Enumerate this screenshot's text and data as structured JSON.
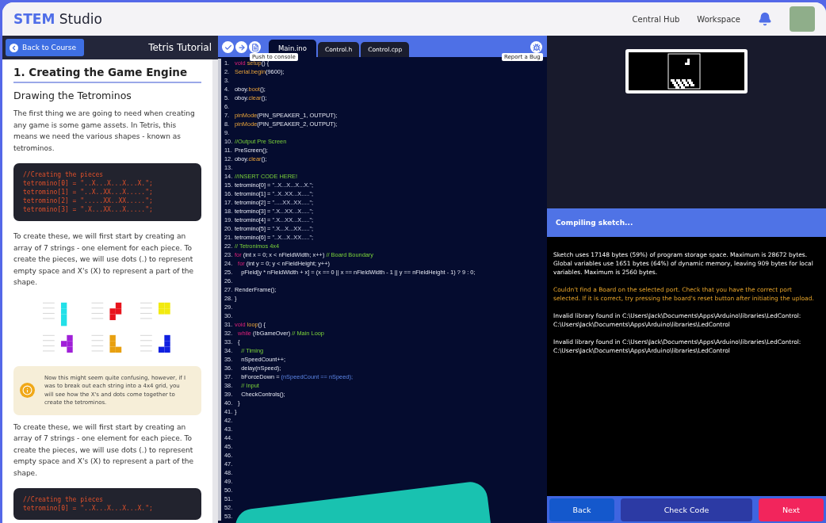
{
  "app": {
    "brand_bold": "STEM",
    "brand_rest": "Studio",
    "nav": [
      "Central Hub",
      "Workspace"
    ]
  },
  "lesson": {
    "back": "Back to Course",
    "title": "Tetris Tutorial",
    "heading": "1. Creating the Game Engine",
    "subheading": "Drawing the Tetrominos",
    "intro": "The first thing we are going to need when creating any game is some game assets. In Tetris, this means we need the various shapes - known as tetrominos.",
    "code_block": [
      "//Creating the pieces",
      "tetromino[0] = \"..X...X...X...X.\";",
      "tetromino[1] = \"..X..XX...X.....\";",
      "tetromino[2] = \".....XX..XX.....\";",
      "tetromino[3] = \".X...XX...X.....\";"
    ],
    "para": "To create these, we will first start by creating an array of 7 strings - one element for each piece. To create the pieces, we will use dots (.) to represent empty space and X's (X) to represent a part of the shape.",
    "pieces": [
      {
        "color": "#22e0e8"
      },
      {
        "color": "#e8141c"
      },
      {
        "color": "#f2ea10"
      },
      {
        "color": "#a020d8"
      },
      {
        "color": "#e8a010"
      },
      {
        "color": "#1020e0"
      }
    ],
    "note": "Now this might seem quite confusing, however, if I was to break out each string into a 4x4 grid, you will see how the X's and dots come together to create the tetrominos.",
    "para2": "To create these, we will first start by creating an array of 7 strings - one element for each piece. To create the pieces, we will use dots (.) to represent empty space and X's (X) to represent a part of the shape.",
    "code_block2": [
      "//Creating the pieces",
      "tetromino[0] = \"..X...X...X...X.\";"
    ]
  },
  "editor": {
    "tooltip_left": "Push to console",
    "tooltip_right": "Report a Bug",
    "tabs": [
      {
        "label": "Main.ino",
        "selected": true
      },
      {
        "label": "Control.h",
        "selected": false
      },
      {
        "label": "Control.cpp",
        "selected": false
      }
    ],
    "lines": [
      {
        "n": "1.",
        "segs": [
          {
            "kind": "kw",
            "text": "void "
          },
          {
            "kind": "fn",
            "text": "setup"
          },
          {
            "kind": "pl",
            "text": "() {"
          }
        ]
      },
      {
        "n": "2.",
        "segs": [
          {
            "kind": "fn",
            "text": "Serial.begin"
          },
          {
            "kind": "pl",
            "text": "(9600);"
          }
        ]
      },
      {
        "n": "3."
      },
      {
        "n": "4.",
        "segs": [
          {
            "kind": "pl",
            "text": "oboy."
          },
          {
            "kind": "fn",
            "text": "boot"
          },
          {
            "kind": "pl",
            "text": "();"
          }
        ]
      },
      {
        "n": "5.",
        "segs": [
          {
            "kind": "pl",
            "text": "oboy."
          },
          {
            "kind": "fn",
            "text": "clear"
          },
          {
            "kind": "pl",
            "text": "();"
          }
        ]
      },
      {
        "n": "6."
      },
      {
        "n": "7.",
        "segs": [
          {
            "kind": "fn",
            "text": "pinMode"
          },
          {
            "kind": "pl",
            "text": "(PIN_SPEAKER_1, OUTPUT);"
          }
        ]
      },
      {
        "n": "8.",
        "segs": [
          {
            "kind": "fn",
            "text": "pinMode"
          },
          {
            "kind": "pl",
            "text": "(PIN_SPEAKER_2, OUTPUT);"
          }
        ]
      },
      {
        "n": "9."
      },
      {
        "n": "10.",
        "segs": [
          {
            "kind": "cm",
            "text": "//Output Pre Screen"
          }
        ]
      },
      {
        "n": "11.",
        "segs": [
          {
            "kind": "pl",
            "text": "PreScreen();"
          }
        ]
      },
      {
        "n": "12.",
        "segs": [
          {
            "kind": "pl",
            "text": "oboy."
          },
          {
            "kind": "fn",
            "text": "clear"
          },
          {
            "kind": "pl",
            "text": "();"
          }
        ]
      },
      {
        "n": "13."
      },
      {
        "n": "14.",
        "segs": [
          {
            "kind": "cm",
            "text": "//INSERT CODE HERE!"
          }
        ]
      },
      {
        "n": "15.",
        "segs": [
          {
            "kind": "pl",
            "text": "tetromino[0] = "
          },
          {
            "kind": "st",
            "text": "\"..X...X...X...X.\";"
          }
        ]
      },
      {
        "n": "16.",
        "segs": [
          {
            "kind": "pl",
            "text": "tetromino[1] = "
          },
          {
            "kind": "st",
            "text": "\"..X..XX...X.....\";"
          }
        ]
      },
      {
        "n": "17.",
        "segs": [
          {
            "kind": "pl",
            "text": "tetromino[2] = "
          },
          {
            "kind": "st",
            "text": "\".....XX..XX.....\";"
          }
        ]
      },
      {
        "n": "18.",
        "segs": [
          {
            "kind": "pl",
            "text": "tetromino[3] = "
          },
          {
            "kind": "st",
            "text": "\".X...XX...X.....\";"
          }
        ]
      },
      {
        "n": "19.",
        "segs": [
          {
            "kind": "pl",
            "text": "tetromino[4] = "
          },
          {
            "kind": "st",
            "text": "\".X...XX...X.....\";"
          }
        ]
      },
      {
        "n": "20.",
        "segs": [
          {
            "kind": "pl",
            "text": "tetromino[5] = "
          },
          {
            "kind": "st",
            "text": "\".X...X...XX.....\";"
          }
        ]
      },
      {
        "n": "21.",
        "segs": [
          {
            "kind": "pl",
            "text": "tetromino[6] = "
          },
          {
            "kind": "st",
            "text": "\"..X...X..XX.....\";"
          }
        ]
      },
      {
        "n": "22.",
        "segs": [
          {
            "kind": "cm",
            "text": "// Tetronimos 4x4"
          }
        ]
      },
      {
        "n": "23.",
        "segs": [
          {
            "kind": "kw",
            "text": "for "
          },
          {
            "kind": "pl",
            "text": "(int x = 0; x < nFieldWidth; x++) "
          },
          {
            "kind": "cm",
            "text": "// Board Boundary"
          }
        ]
      },
      {
        "n": "24.",
        "segs": [
          {
            "kind": "kw",
            "text": "  for "
          },
          {
            "kind": "pl",
            "text": "(int y = 0; y < nFieldHeight; y++)"
          }
        ]
      },
      {
        "n": "25.",
        "segs": [
          {
            "kind": "pl",
            "text": "    pField[y * nFieldWidth + x] = (x == 0 || x == nFieldWidth - 1 || y == nFieldHeight - 1) ? 9 : 0;"
          }
        ]
      },
      {
        "n": "26."
      },
      {
        "n": "27.",
        "segs": [
          {
            "kind": "pl",
            "text": "RenderFrame();"
          }
        ]
      },
      {
        "n": "28.",
        "segs": [
          {
            "kind": "pl",
            "text": "}"
          }
        ]
      },
      {
        "n": "29."
      },
      {
        "n": "30."
      },
      {
        "n": "31.",
        "segs": [
          {
            "kind": "kw",
            "text": "void "
          },
          {
            "kind": "fn",
            "text": "loop"
          },
          {
            "kind": "pl",
            "text": "() {"
          }
        ]
      },
      {
        "n": "32.",
        "segs": [
          {
            "kind": "kw",
            "text": "  while "
          },
          {
            "kind": "pl",
            "text": "(!bGameOver) "
          },
          {
            "kind": "cm",
            "text": "// Main Loop"
          }
        ]
      },
      {
        "n": "33.",
        "segs": [
          {
            "kind": "pl",
            "text": "  {"
          }
        ]
      },
      {
        "n": "34.",
        "segs": [
          {
            "kind": "cm",
            "text": "    // Timing"
          }
        ]
      },
      {
        "n": "35.",
        "segs": [
          {
            "kind": "pl",
            "text": "    nSpeedCount++;"
          }
        ]
      },
      {
        "n": "36.",
        "segs": [
          {
            "kind": "pl",
            "text": "    delay(nSpeed);"
          }
        ]
      },
      {
        "n": "37.",
        "segs": [
          {
            "kind": "pl",
            "text": "    bForceDown = "
          },
          {
            "kind": "op",
            "text": "(nSpeedCount == nSpeed);"
          }
        ]
      },
      {
        "n": "38.",
        "segs": [
          {
            "kind": "cm",
            "text": "    // Input"
          }
        ]
      },
      {
        "n": "39.",
        "segs": [
          {
            "kind": "pl",
            "text": "    CheckControls();"
          }
        ]
      },
      {
        "n": "40.",
        "segs": [
          {
            "kind": "pl",
            "text": "  }"
          }
        ]
      },
      {
        "n": "41.",
        "segs": [
          {
            "kind": "pl",
            "text": "}"
          }
        ]
      },
      {
        "n": "42."
      },
      {
        "n": "43."
      },
      {
        "n": "44."
      },
      {
        "n": "45."
      },
      {
        "n": "46."
      },
      {
        "n": "47."
      },
      {
        "n": "48."
      },
      {
        "n": "49."
      },
      {
        "n": "50."
      },
      {
        "n": "51."
      },
      {
        "n": "52."
      },
      {
        "n": "53."
      }
    ]
  },
  "console": {
    "title": "Compiling sketch...",
    "messages": [
      {
        "kind": "info",
        "text": "Sketch uses 17148 bytes (59%) of program storage space. Maximum is 28672 bytes. Global variables use 1651 bytes (64%) of dynamic memory, leaving 909 bytes for local variables. Maximum is 2560 bytes."
      },
      {
        "kind": "warning",
        "text": "Couldn't find a Board on the selected port. Check that you have the correct port selected.  If it is correct, try pressing the board's reset button after initiating the upload."
      },
      {
        "kind": "info",
        "text": "Invalid library found in C:\\Users\\Jack\\Documents\\Apps\\Arduino\\libraries\\LedControl: C:\\Users\\Jack\\Documents\\Apps\\Arduino\\libraries\\LedControl"
      },
      {
        "kind": "info",
        "text": "Invalid library found in C:\\Users\\Jack\\Documents\\Apps\\Arduino\\libraries\\LedControl: C:\\Users\\Jack\\Documents\\Apps\\Arduino\\libraries\\LedControl"
      }
    ],
    "buttons": [
      {
        "label": "Back",
        "kind": "back"
      },
      {
        "label": "Check Code",
        "kind": "check"
      },
      {
        "label": "Next",
        "kind": "next"
      }
    ]
  }
}
